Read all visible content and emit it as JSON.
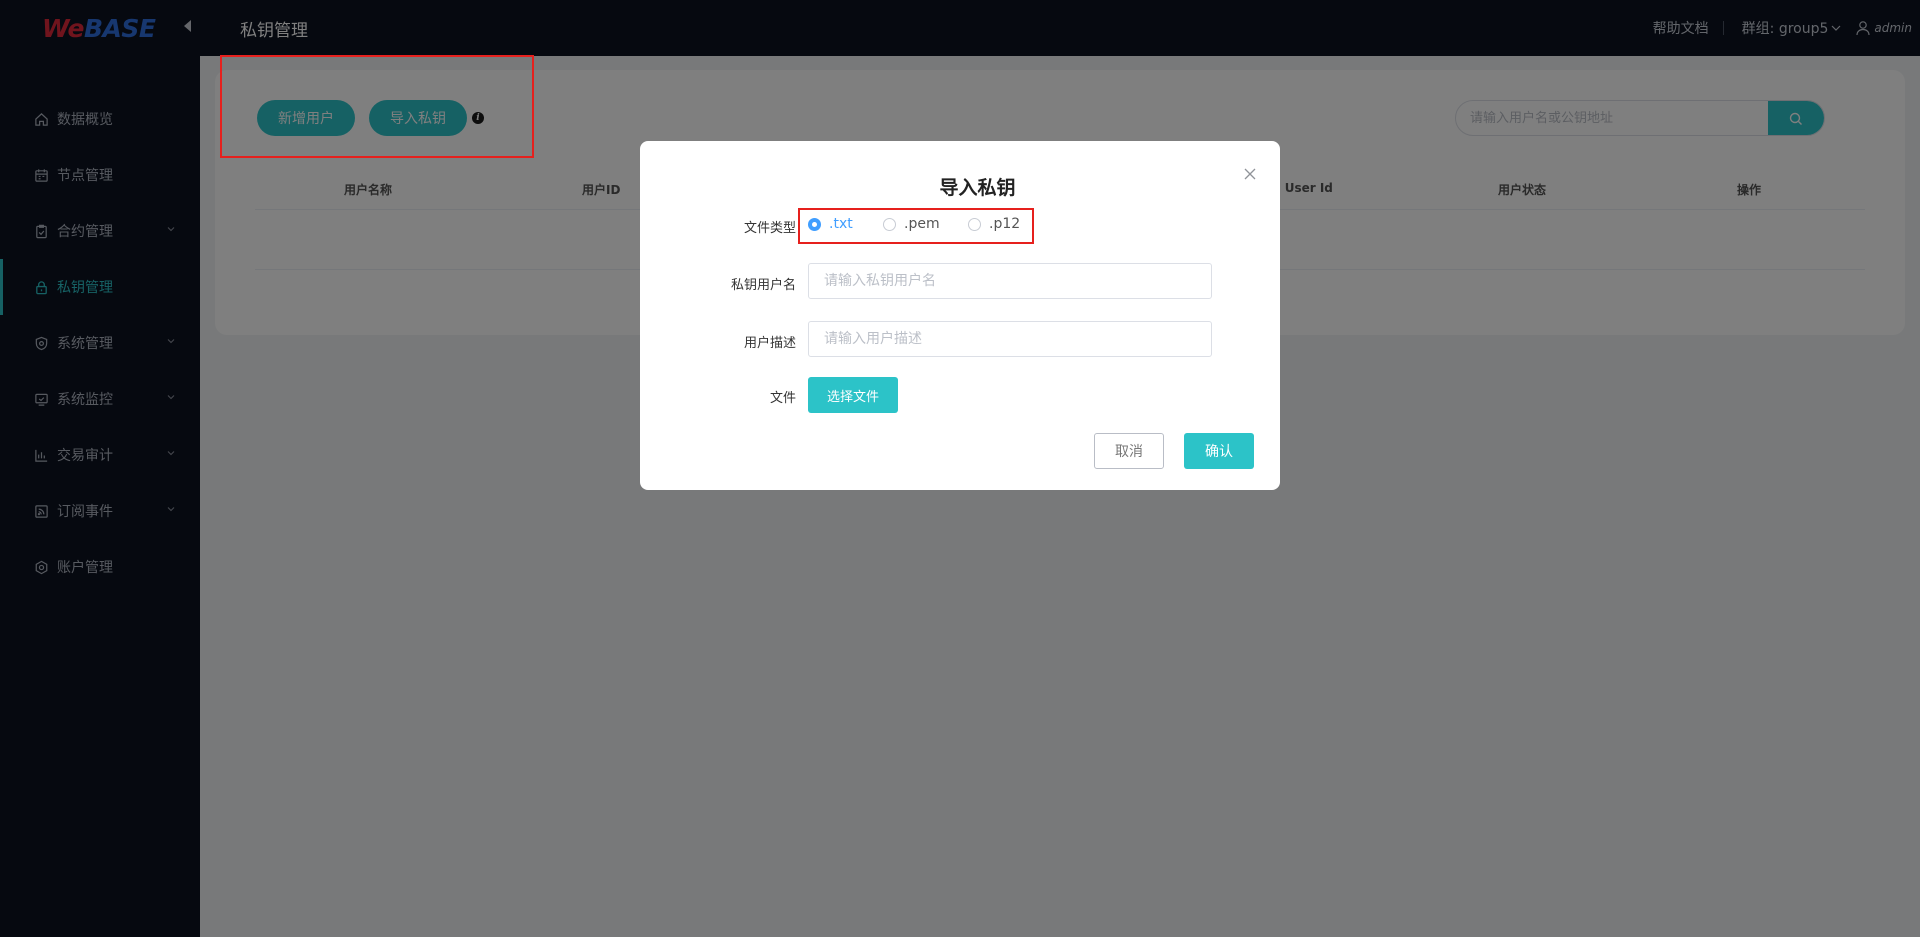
{
  "brand": {
    "logo_we": "We",
    "logo_base": "BASE"
  },
  "sidebar": {
    "items": [
      {
        "label": "数据概览",
        "icon": "home-icon",
        "has_children": false
      },
      {
        "label": "节点管理",
        "icon": "calendar-icon",
        "has_children": false
      },
      {
        "label": "合约管理",
        "icon": "clipboard-icon",
        "has_children": true
      },
      {
        "label": "私钥管理",
        "icon": "lock-icon",
        "has_children": false,
        "active": true
      },
      {
        "label": "系统管理",
        "icon": "shield-icon",
        "has_children": true
      },
      {
        "label": "系统监控",
        "icon": "monitor-icon",
        "has_children": true
      },
      {
        "label": "交易审计",
        "icon": "bar-chart-icon",
        "has_children": true
      },
      {
        "label": "订阅事件",
        "icon": "rss-icon",
        "has_children": true
      },
      {
        "label": "账户管理",
        "icon": "settings-icon",
        "has_children": false
      }
    ]
  },
  "header": {
    "title": "私钥管理",
    "help": "帮助文档",
    "group": "群组: group5",
    "user": "admin"
  },
  "main": {
    "add_user": "新增用户",
    "import_key": "导入私钥",
    "info_glyph": "i",
    "search_placeholder": "请输入用户名或公钥地址",
    "columns": [
      "用户名称",
      "用户ID",
      "n User Id",
      "用户状态",
      "操作"
    ]
  },
  "dialog": {
    "title": "导入私钥",
    "file_type_label": "文件类型",
    "file_types": [
      ".txt",
      ".pem",
      ".p12"
    ],
    "selected_file_type": ".txt",
    "username_label": "私钥用户名",
    "username_placeholder": "请输入私钥用户名",
    "username_value": "",
    "desc_label": "用户描述",
    "desc_placeholder": "请输入用户描述",
    "desc_value": "",
    "file_label": "文件",
    "choose_file": "选择文件",
    "cancel": "取消",
    "confirm": "确认"
  },
  "colors": {
    "accent": "#2cc3c8",
    "sidebar_bg": "#0c1220",
    "radio_selected": "#409eff",
    "annotation": "#e6201d"
  }
}
